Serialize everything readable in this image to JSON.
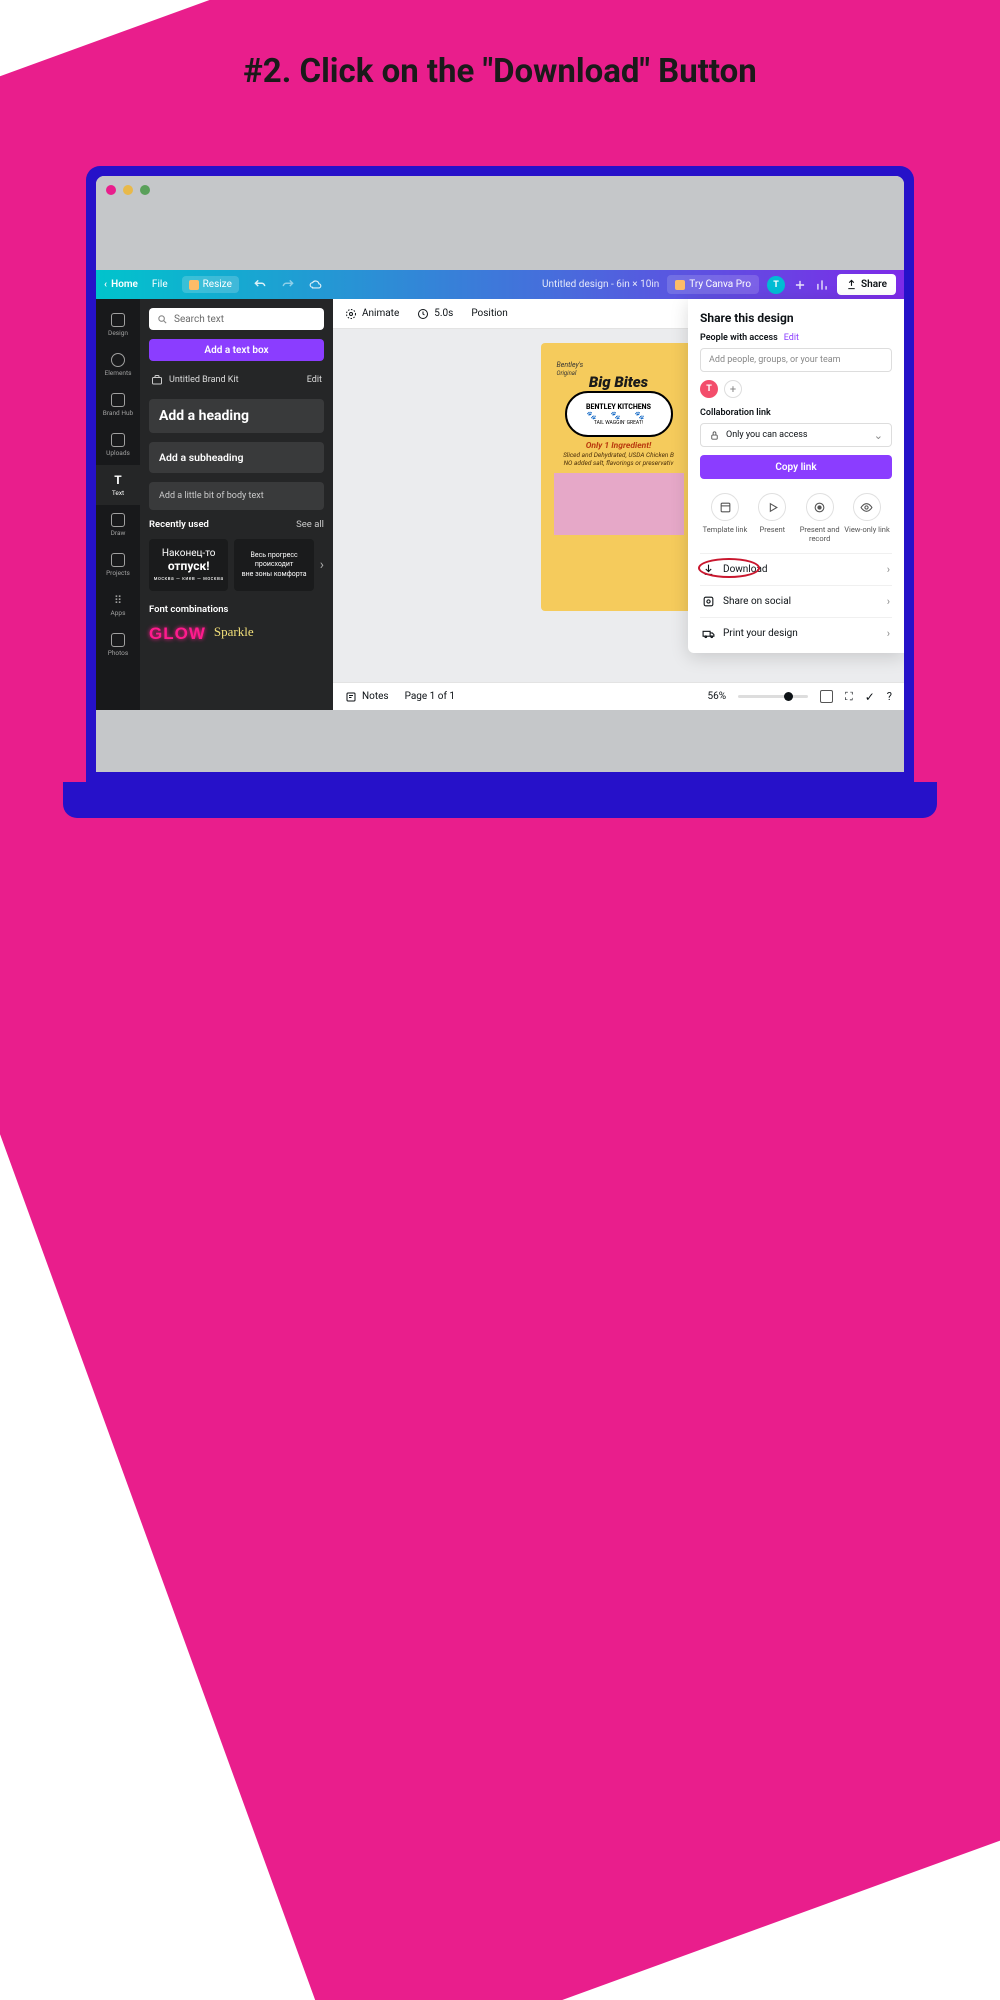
{
  "instruction": "#2. Click on the \"Download\" Button",
  "topbar": {
    "home": "Home",
    "file": "File",
    "resize": "Resize",
    "doc_title": "Untitled design - 6in × 10in",
    "try_pro": "Try Canva Pro",
    "avatar_letter": "T",
    "share": "Share"
  },
  "siderail": {
    "items": [
      "Design",
      "Elements",
      "Brand Hub",
      "Uploads",
      "Text",
      "Draw",
      "Projects",
      "Apps",
      "Photos"
    ],
    "active_index": 4
  },
  "sidepanel": {
    "search_placeholder": "Search text",
    "add_text_box": "Add a text box",
    "brand_kit": "Untitled Brand Kit",
    "edit": "Edit",
    "heading": "Add a heading",
    "subheading": "Add a subheading",
    "body": "Add a little bit of body text",
    "recently_used": "Recently used",
    "see_all": "See all",
    "recent_card_1a": "Наконец-то",
    "recent_card_1b": "отпуск!",
    "recent_card_1c": "москва — киев — москва",
    "recent_card_2a": "Весь прогресс",
    "recent_card_2b": "происходит",
    "recent_card_2c": "вне зоны комфорта",
    "font_combinations": "Font combinations",
    "glow": "GLOW",
    "sparkle": "Sparkle"
  },
  "contextbar": {
    "animate": "Animate",
    "duration": "5.0s",
    "position": "Position"
  },
  "product": {
    "bentleys": "Bentley's",
    "original": "Original",
    "big_bites": "Big Bites",
    "brand": "BENTLEY KITCHENS",
    "tagline": "TAIL WAGGIN' GREAT!",
    "only_one": "Only 1 Ingredient!",
    "desc1": "Sliced and Dehydrated, USDA Chicken B",
    "desc2": "NO added salt, flavorings or preservativ"
  },
  "bottombar": {
    "notes": "Notes",
    "page": "Page 1 of 1",
    "zoom": "56%"
  },
  "share_panel": {
    "title": "Share this design",
    "people_with_access": "People with access",
    "edit": "Edit",
    "add_placeholder": "Add people, groups, or your team",
    "avatar_letter": "T",
    "collab_link": "Collaboration link",
    "access_select": "Only you can access",
    "copy_link": "Copy link",
    "options": [
      "Template link",
      "Present",
      "Present and record",
      "View-only link"
    ],
    "rows": [
      "Download",
      "Share on social",
      "Print your design"
    ]
  }
}
